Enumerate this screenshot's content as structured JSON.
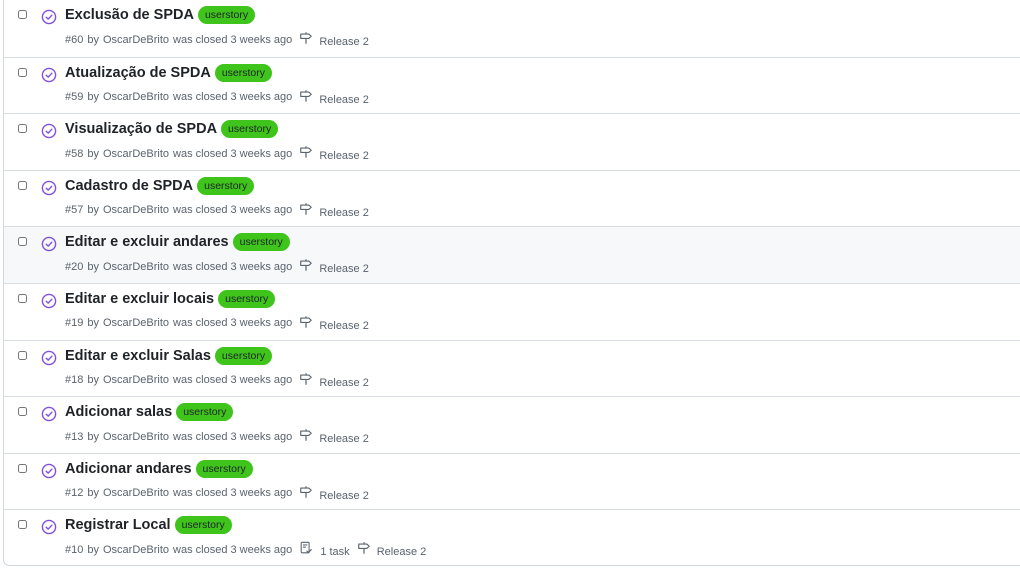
{
  "colors": {
    "closed_icon": "#8250df",
    "label_bg": "#3ec41b",
    "meta_text": "#59636e"
  },
  "icons": {
    "state": "issue-closed-icon",
    "milestone": "milestone-icon",
    "tasks": "checklist-icon"
  },
  "issues": [
    {
      "title": "Exclusão de SPDA",
      "label": "userstory",
      "number": "#60",
      "by": "by",
      "author": "OscarDeBrito",
      "status": "was closed 3 weeks ago",
      "tasks": "",
      "milestone": "Release 2"
    },
    {
      "title": "Atualização de SPDA",
      "label": "userstory",
      "number": "#59",
      "by": "by",
      "author": "OscarDeBrito",
      "status": "was closed 3 weeks ago",
      "tasks": "",
      "milestone": "Release 2"
    },
    {
      "title": "Visualização de SPDA",
      "label": "userstory",
      "number": "#58",
      "by": "by",
      "author": "OscarDeBrito",
      "status": "was closed 3 weeks ago",
      "tasks": "",
      "milestone": "Release 2"
    },
    {
      "title": "Cadastro de SPDA",
      "label": "userstory",
      "number": "#57",
      "by": "by",
      "author": "OscarDeBrito",
      "status": "was closed 3 weeks ago",
      "tasks": "",
      "milestone": "Release 2"
    },
    {
      "title": "Editar e excluir andares",
      "label": "userstory",
      "number": "#20",
      "by": "by",
      "author": "OscarDeBrito",
      "status": "was closed 3 weeks ago",
      "tasks": "",
      "milestone": "Release 2"
    },
    {
      "title": "Editar e excluir locais",
      "label": "userstory",
      "number": "#19",
      "by": "by",
      "author": "OscarDeBrito",
      "status": "was closed 3 weeks ago",
      "tasks": "",
      "milestone": "Release 2"
    },
    {
      "title": "Editar e excluir Salas",
      "label": "userstory",
      "number": "#18",
      "by": "by",
      "author": "OscarDeBrito",
      "status": "was closed 3 weeks ago",
      "tasks": "",
      "milestone": "Release 2"
    },
    {
      "title": "Adicionar salas",
      "label": "userstory",
      "number": "#13",
      "by": "by",
      "author": "OscarDeBrito",
      "status": "was closed 3 weeks ago",
      "tasks": "",
      "milestone": "Release 2"
    },
    {
      "title": "Adicionar andares",
      "label": "userstory",
      "number": "#12",
      "by": "by",
      "author": "OscarDeBrito",
      "status": "was closed 3 weeks ago",
      "tasks": "",
      "milestone": "Release 2"
    },
    {
      "title": "Registrar Local",
      "label": "userstory",
      "number": "#10",
      "by": "by",
      "author": "OscarDeBrito",
      "status": "was closed 3 weeks ago",
      "tasks": "1 task",
      "milestone": "Release 2"
    }
  ]
}
